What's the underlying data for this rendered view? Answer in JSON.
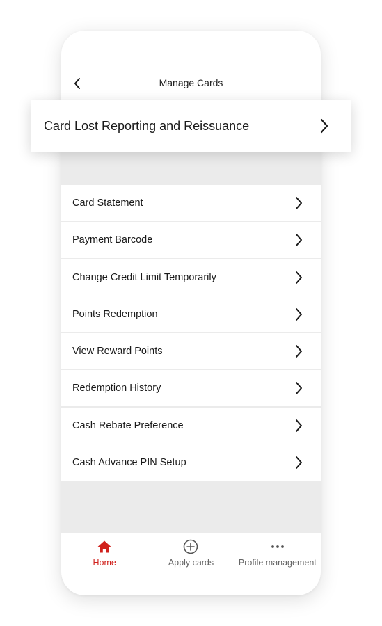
{
  "header": {
    "title": "Manage Cards"
  },
  "featured_item": {
    "label": "Card Lost Reporting and Reissuance"
  },
  "menu": {
    "items": [
      {
        "label": "Card Statement"
      },
      {
        "label": "Payment Barcode"
      },
      {
        "label": "Change Credit Limit Temporarily"
      },
      {
        "label": "Points Redemption"
      },
      {
        "label": "View Reward Points"
      },
      {
        "label": "Redemption History"
      },
      {
        "label": "Cash Rebate Preference"
      },
      {
        "label": "Cash Advance PIN Setup"
      }
    ]
  },
  "tabbar": {
    "tabs": [
      {
        "label": "Home",
        "icon": "home-icon",
        "active": true
      },
      {
        "label": "Apply cards",
        "icon": "plus-circle-icon",
        "active": false
      },
      {
        "label": "Profile management",
        "icon": "more-icon",
        "active": false
      }
    ]
  },
  "colors": {
    "accent": "#d0211c",
    "background": "#ebebeb",
    "surface": "#ffffff"
  }
}
